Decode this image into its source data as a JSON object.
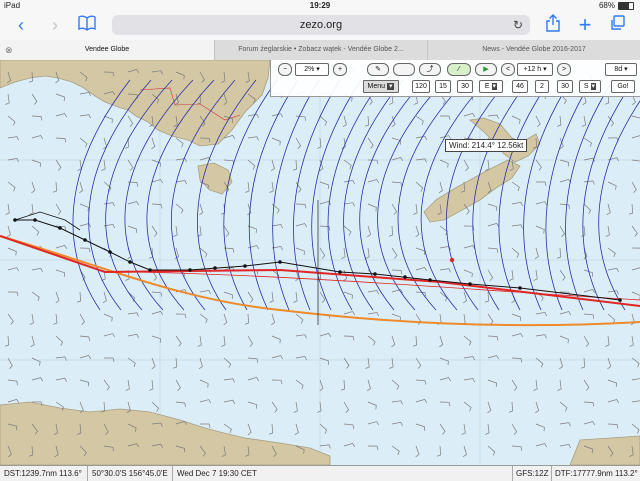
{
  "status": {
    "device": "iPad",
    "time": "19:29",
    "battery": "68%",
    "battery_fraction": 0.68
  },
  "browser": {
    "url": "zezo.org",
    "tabs": [
      {
        "label": "Vendee Globe",
        "active": true
      },
      {
        "label": "Forum żeglarskie • Zobacz wątek - Vendée Globe 2...",
        "active": false
      },
      {
        "label": "News - Vendée Globe 2016-2017",
        "active": false
      }
    ]
  },
  "controls": {
    "zoom_minus": "−",
    "zoom_value": "2%",
    "zoom_plus": "+",
    "step_back": "<",
    "step_time": "+12 h",
    "step_forward": ">",
    "duration": "8d",
    "menu": "Menu",
    "lon_deg": "120",
    "lon_min": "15",
    "lon_sec": "30",
    "lon_hemi": "E",
    "lat_deg": "46",
    "lat_min": "2",
    "lat_sec": "30",
    "lat_hemi": "S",
    "go": "Go!"
  },
  "wind_tooltip": "Wind: 214.4° 12.56kt",
  "footer": {
    "dst": "DST:1239.7nm 113.6°",
    "position": "50°30.0'S 156°45.0'E",
    "datetime": "Wed Dec  7 19:30 CET",
    "gfs": "GFS:12Z",
    "dtf": "DTF:17777.9nm 113.2°"
  },
  "colors": {
    "sea": "#dbeef8",
    "land": "#d4c7a4",
    "route_red": "#e02525",
    "route_orange": "#ee8a2a",
    "isochrone": "#2630a8",
    "wind_barb": "#7a7a7a",
    "accent": "#2f7bf5"
  }
}
